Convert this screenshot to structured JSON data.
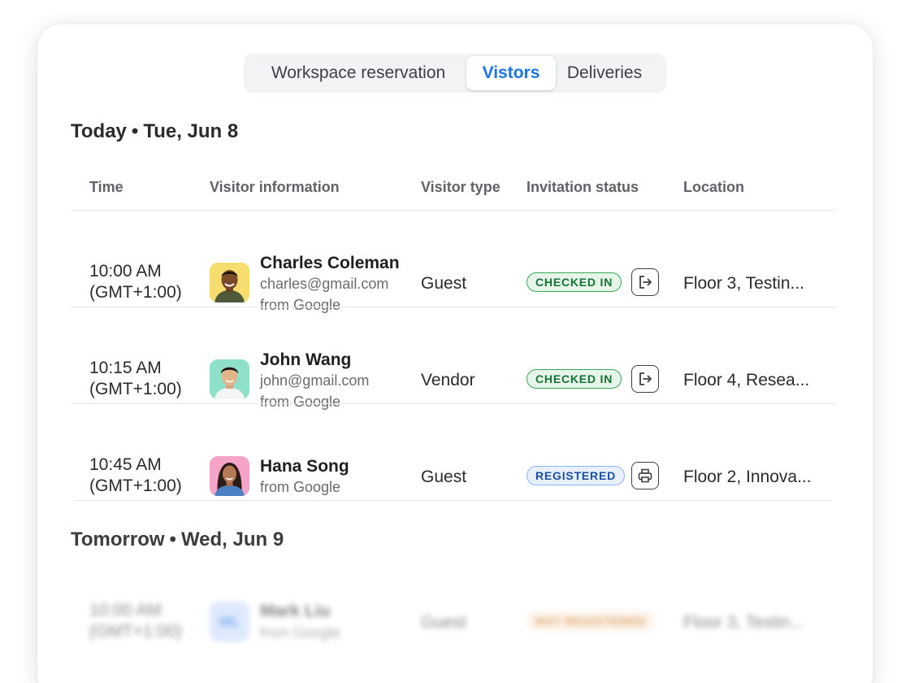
{
  "tabs": [
    {
      "label": "Workspace reservation",
      "active": false
    },
    {
      "label": "Vistors",
      "active": true
    },
    {
      "label": "Deliveries",
      "active": false
    }
  ],
  "today": {
    "day": "Today",
    "date": "Tue, Jun 8"
  },
  "table_headers": {
    "time": "Time",
    "visitor_info": "Visitor information",
    "visitor_type": "Visitor type",
    "invitation_status": "Invitation status",
    "location": "Location"
  },
  "rows": [
    {
      "time_line1": "10:00 AM",
      "time_line2": "(GMT+1:00)",
      "name": "Charles Coleman",
      "email": "charles@gmail.com",
      "org": "from Google",
      "type": "Guest",
      "status": "CHECKED IN",
      "action_icon": "check-out-icon",
      "location": "Floor 3, Testin..."
    },
    {
      "time_line1": "10:15 AM",
      "time_line2": "(GMT+1:00)",
      "name": "John Wang",
      "email": "john@gmail.com",
      "org": "from Google",
      "type": "Vendor",
      "status": "CHECKED IN",
      "action_icon": "check-out-icon",
      "location": "Floor 4, Resea..."
    },
    {
      "time_line1": "10:45 AM",
      "time_line2": "(GMT+1:00)",
      "name": "Hana Song",
      "org": "from Google",
      "type": "Guest",
      "status": "REGISTERED",
      "action_icon": "print-icon",
      "location": "Floor 2, Innova..."
    }
  ],
  "tomorrow": {
    "day": "Tomorrow",
    "date": "Wed, Jun 9",
    "row": {
      "time_line1": "10:00 AM",
      "time_line2": "(GMT+1:00)",
      "initials": "ML",
      "name": "Mark Liu",
      "org": "from Google",
      "type": "Guest",
      "status": "NOT REGISTERED",
      "location": "Floor 3, Testin..."
    }
  },
  "colors": {
    "accent": "#1a73e8",
    "checked_in": "#137333",
    "registered": "#174ea6",
    "not_registered": "#c26401"
  }
}
